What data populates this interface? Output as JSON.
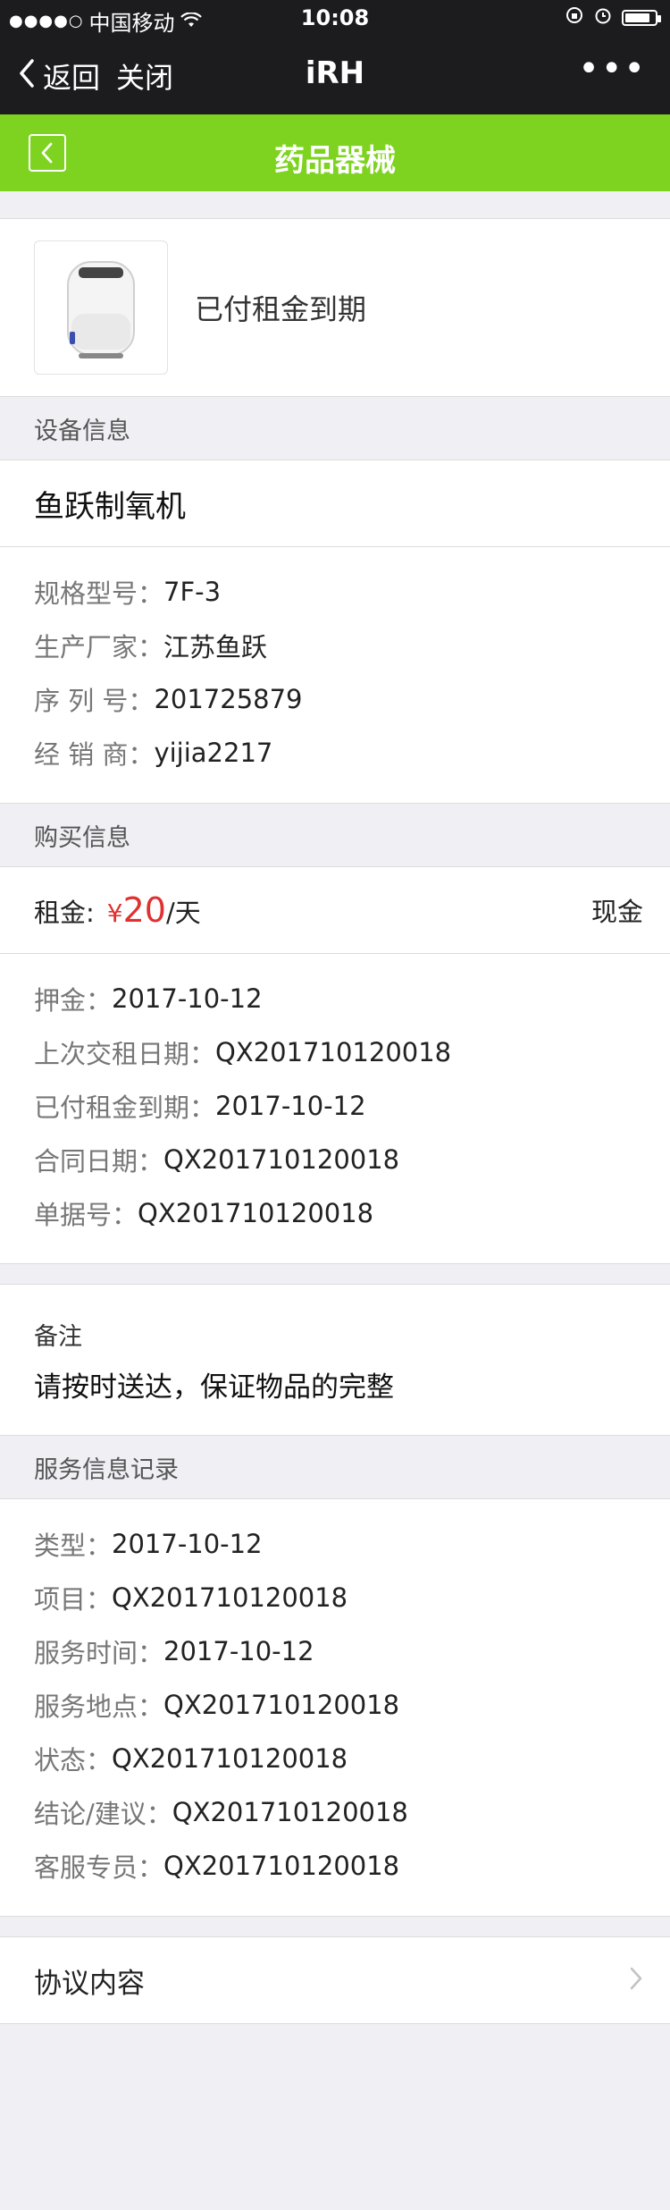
{
  "status_bar": {
    "signal": "●●●●○",
    "carrier": "中国移动",
    "time": "10:08",
    "battery_level": 0.85
  },
  "wx_nav": {
    "back_label": "返回",
    "close_label": "关闭",
    "title": "iRH",
    "more": "•••"
  },
  "page": {
    "title": "药品器械"
  },
  "product": {
    "status": "已付租金到期"
  },
  "device_info": {
    "header": "设备信息",
    "name": "鱼跃制氧机",
    "rows": [
      {
        "key": "规格型号：",
        "value": "7F-3"
      },
      {
        "key": "生产厂家：",
        "value": "江苏鱼跃"
      },
      {
        "key": "序 列 号：",
        "value": "201725879"
      },
      {
        "key": "经 销 商：",
        "value": "yijia2217"
      }
    ]
  },
  "purchase_info": {
    "header": "购买信息",
    "rent_label": "租金:",
    "currency": "¥",
    "rent_amount": "20",
    "rent_unit": "/天",
    "payment_method": "现金",
    "rows": [
      {
        "key": "押金：",
        "value": "2017-10-12"
      },
      {
        "key": "上次交租日期：",
        "value": "QX201710120018"
      },
      {
        "key": "已付租金到期：",
        "value": "2017-10-12"
      },
      {
        "key": "合同日期：",
        "value": "QX201710120018"
      },
      {
        "key": "单据号：",
        "value": "QX201710120018"
      }
    ]
  },
  "remark": {
    "label": "备注",
    "text": "请按时送达，保证物品的完整"
  },
  "service_info": {
    "header": "服务信息记录",
    "rows": [
      {
        "key": "类型：",
        "value": "2017-10-12"
      },
      {
        "key": "项目：",
        "value": "QX201710120018"
      },
      {
        "key": "服务时间：",
        "value": "2017-10-12"
      },
      {
        "key": "服务地点：",
        "value": "QX201710120018"
      },
      {
        "key": "状态：",
        "value": "QX201710120018"
      },
      {
        "key": "结论/建议：",
        "value": "QX201710120018"
      },
      {
        "key": "客服专员：",
        "value": "QX201710120018"
      }
    ]
  },
  "agreement": {
    "label": "协议内容"
  },
  "colors": {
    "accent_green": "#7ed321",
    "price_red": "#e03030",
    "nav_dark": "#1c1c1e"
  }
}
